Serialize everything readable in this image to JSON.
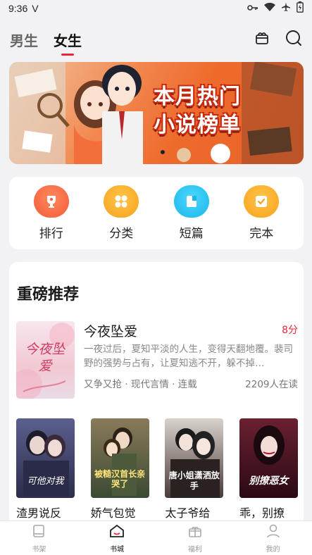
{
  "status_bar": {
    "time": "9:36",
    "carrier_mark": "V"
  },
  "header": {
    "tabs": [
      {
        "label": "男生",
        "active": false
      },
      {
        "label": "女生",
        "active": true
      }
    ],
    "icons": [
      "gift-box-icon",
      "search-icon"
    ]
  },
  "banner": {
    "line1": "本月热门",
    "line2": "小说榜单"
  },
  "quick_actions": [
    {
      "label": "排行",
      "icon": "trophy-icon",
      "color": "#f25a3a"
    },
    {
      "label": "分类",
      "icon": "category-grid-icon",
      "color": "#f7a21b"
    },
    {
      "label": "短篇",
      "icon": "short-story-icon",
      "color": "#18b8ea"
    },
    {
      "label": "完本",
      "icon": "complete-check-icon",
      "color": "#f7a21b"
    }
  ],
  "recommend": {
    "heading": "重磅推荐",
    "featured": {
      "title": "今夜坠爱",
      "score": "8分",
      "description": "一夜过后，夏知平淡的人生，变得天翻地覆。裴司野的强势与占有，让夏知逃不开，躲不掉…",
      "meta": "又争又抢 · 现代言情 · 连载",
      "readers": "2209人在读",
      "cover_text": "今夜坠爱"
    },
    "books": [
      {
        "title": "渣男说反",
        "cover_text": "可他对我"
      },
      {
        "title": "娇气包觉",
        "cover_text": "被糙汉首长亲哭了"
      },
      {
        "title": "太子爷给",
        "cover_text": "唐小姐潇洒放手"
      },
      {
        "title": "乖，别撩",
        "cover_text": "别撩恶女"
      }
    ]
  },
  "bottom_nav": [
    {
      "label": "书架",
      "active": false
    },
    {
      "label": "书城",
      "active": true
    },
    {
      "label": "福利",
      "active": false
    },
    {
      "label": "我的",
      "active": false
    }
  ],
  "colors": {
    "accent": "#e8263a",
    "page_bg": "#f2f2f4"
  }
}
